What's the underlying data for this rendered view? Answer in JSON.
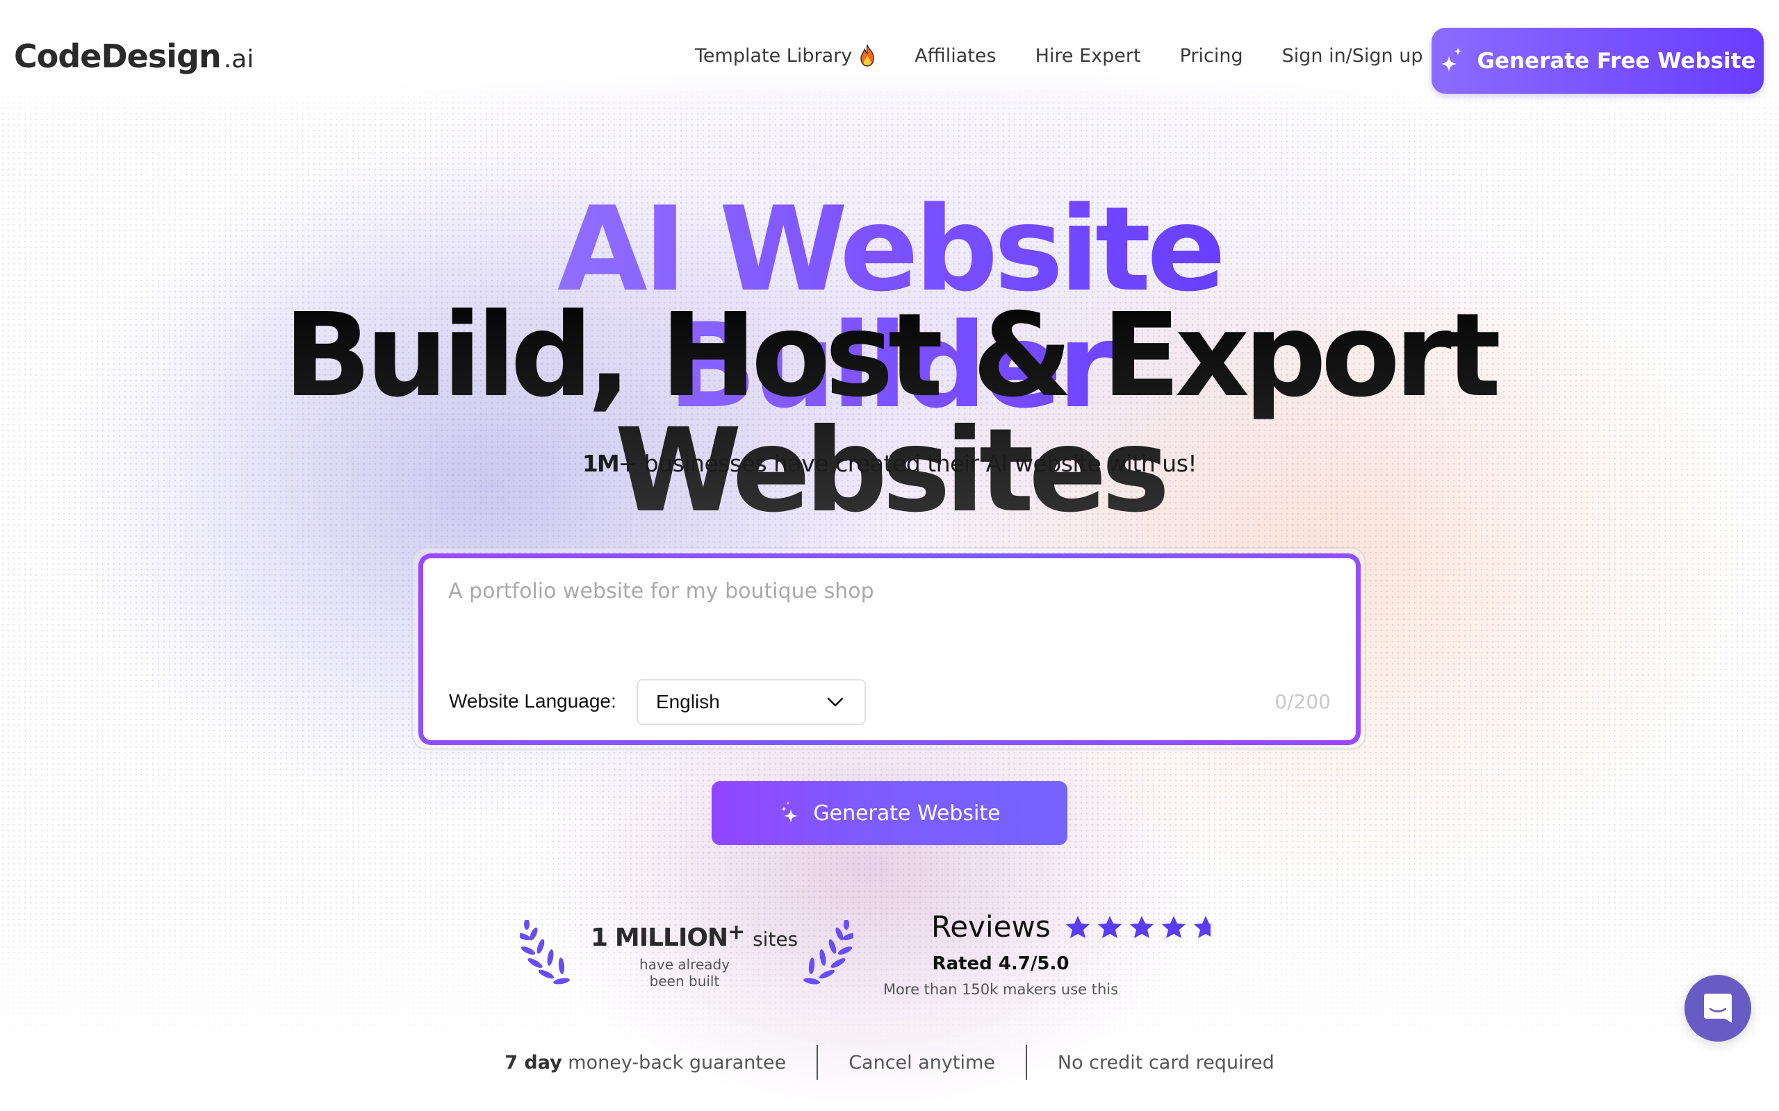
{
  "brand": {
    "name": "CodeDesign",
    "tld": ".ai",
    "accent": "#7b52ff",
    "accent_dark": "#5f36ff",
    "chat_color": "#6a5ac4"
  },
  "nav": {
    "items": [
      {
        "label": "Template Library",
        "icon": "fire-icon"
      },
      {
        "label": "Affiliates"
      },
      {
        "label": "Hire Expert"
      },
      {
        "label": "Pricing"
      },
      {
        "label": "Sign in/Sign up"
      }
    ],
    "cta": {
      "label": "Generate Free Website",
      "icon": "sparkle-icon"
    }
  },
  "hero": {
    "title": "AI Website Builder",
    "subtitle": "Build, Host & Export Websites",
    "tagline_bold": "1M",
    "tagline_rest": "+ businesses have created their AI website with us!"
  },
  "prompt": {
    "placeholder": "A portfolio website for my boutique shop",
    "value": "",
    "language_label": "Website Language:",
    "language_selected": "English",
    "counter": "0/200",
    "generate_label": "Generate Website"
  },
  "social_proof": {
    "million": {
      "number": "1",
      "word": "MILLION",
      "plus": "+",
      "suffix": "sites",
      "line1": "have already",
      "line2": "been built"
    },
    "reviews": {
      "title": "Reviews",
      "rating": 4.7,
      "max": 5,
      "rated_text": "Rated 4.7/5.0",
      "makers_text": "More than 150k makers use this"
    }
  },
  "guarantees": [
    {
      "bold": "7 day",
      "text": " money-back guarantee"
    },
    {
      "text": "Cancel anytime"
    },
    {
      "text": "No credit card required"
    }
  ]
}
